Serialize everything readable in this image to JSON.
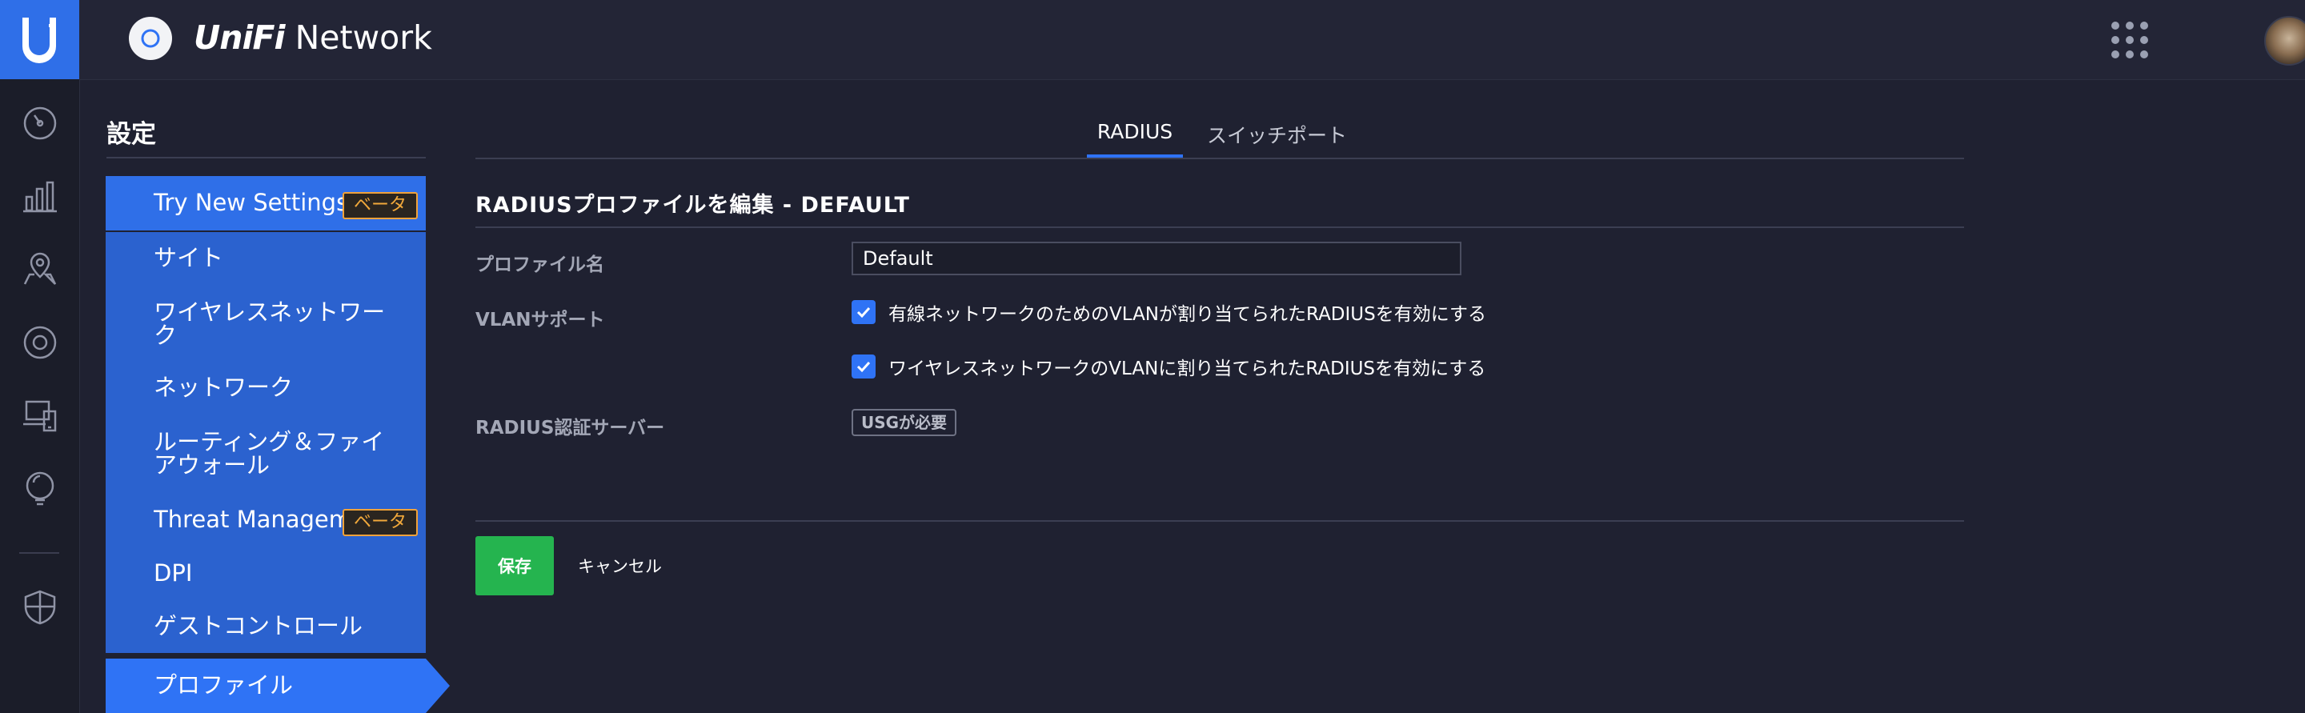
{
  "app": {
    "brand_prefix": "UniFi",
    "brand_suffix": " Network",
    "accent": "#2f73f5",
    "save_color": "#25b44f"
  },
  "rail": {
    "icons": [
      "ubiquiti-logo-icon",
      "dashboard-icon",
      "statistics-icon",
      "map-icon",
      "devices-icon",
      "clients-icon",
      "insights-icon",
      "security-icon"
    ]
  },
  "topbar": {
    "icons": [
      "controller-icon",
      "apps-grid-icon",
      "avatar"
    ]
  },
  "settings": {
    "title": "設定",
    "beta_label": "ベータ",
    "items": [
      {
        "label": "Try New Settings",
        "badge": "ベータ"
      },
      {
        "label": "サイト"
      },
      {
        "label": "ワイヤレスネットワーク"
      },
      {
        "label": "ネットワーク"
      },
      {
        "label": "ルーティング＆ファイアウォール"
      },
      {
        "label": "Threat Management",
        "badge": "ベータ"
      },
      {
        "label": "DPI"
      },
      {
        "label": "ゲストコントロール"
      },
      {
        "label": "プロファイル"
      }
    ]
  },
  "tabs": [
    {
      "label": "RADIUS",
      "active": true
    },
    {
      "label": "スイッチポート",
      "active": false
    }
  ],
  "form": {
    "section_title": "RADIUSプロファイルを編集 - DEFAULT",
    "profile_name_label": "プロファイル名",
    "profile_name_value": "Default",
    "vlan_label": "VLANサポート",
    "vlan_wired_label": "有線ネットワークのためのVLANが割り当てられたRADIUSを有効にする",
    "vlan_wired_checked": true,
    "vlan_wireless_label": "ワイヤレスネットワークのVLANに割り当てられたRADIUSを有効にする",
    "vlan_wireless_checked": true,
    "auth_server_label": "RADIUS認証サーバー",
    "usg_required": "USGが必要"
  },
  "actions": {
    "save_label": "保存",
    "cancel_label": "キャンセル"
  }
}
